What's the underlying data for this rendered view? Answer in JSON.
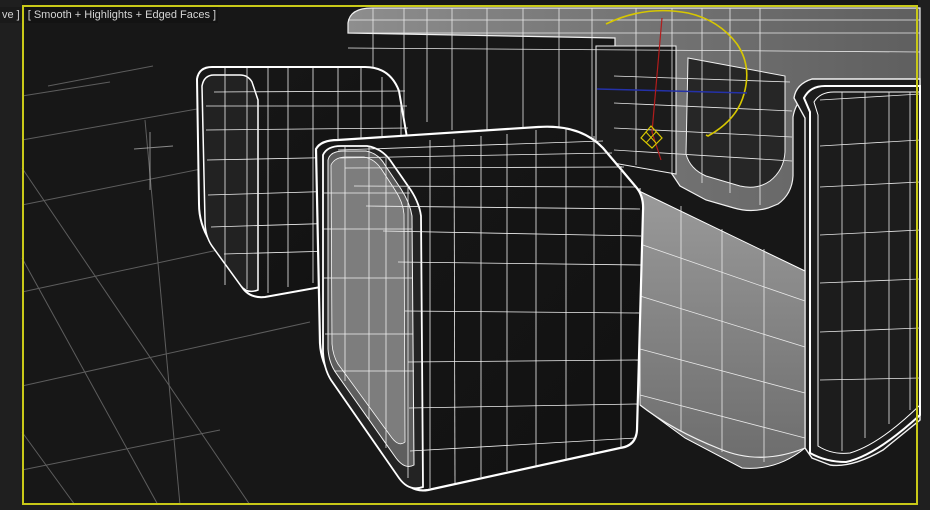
{
  "viewport": {
    "left_label": "ve ]",
    "right_label": "[ Smooth + Highlights + Edged Faces ]"
  },
  "colors": {
    "background": "#171717",
    "grid": "#666666",
    "object_dark": "#1d1d1d",
    "object_light": "#8a8a8a",
    "wire": "#f2f2f2",
    "accent_yellow": "#d7c700",
    "accent_red": "#b21c1c",
    "accent_blue": "#2431a8",
    "viewport_border": "#c9c918"
  }
}
